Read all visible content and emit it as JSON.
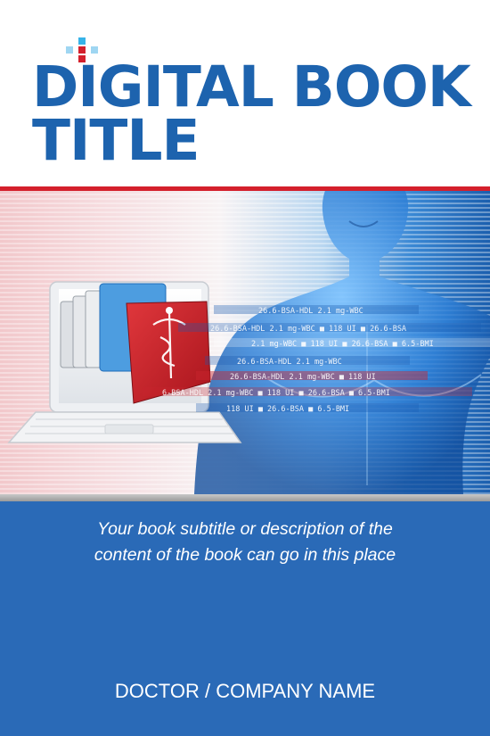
{
  "cover": {
    "title_line1": "DIGITAL BOOK",
    "title_line2": "TITLE",
    "subtitle_line1": "Your book subtitle or description of the",
    "subtitle_line2": "content of the book can go in this place",
    "author": "DOCTOR / COMPANY NAME"
  },
  "overlay": {
    "lines": [
      "26.6-BSA-HDL 2.1 mg-WBC",
      "26.6-BSA-HDL 2.1 mg-WBC ■ 118 UI ■ 26.6-BSA",
      "2.1 mg-WBC ■ 118 UI ■ 26.6-BSA ■ 6.5-BMI",
      "26.6-BSA-HDL 2.1 mg-WBC",
      "26.6-BSA-HDL 2.1 mg-WBC ■ 118 UI",
      "6-BSA-HDL 2.1 mg-WBC ■ 118 UI ■ 26.6-BSA ■ 6.5-BMI",
      "118 UI ■ 26.6-BSA ■ 6.5-BMI"
    ]
  },
  "colors": {
    "brand_blue": "#1d63ae",
    "accent_red": "#d4202c",
    "panel_blue": "#2a6ab7"
  }
}
